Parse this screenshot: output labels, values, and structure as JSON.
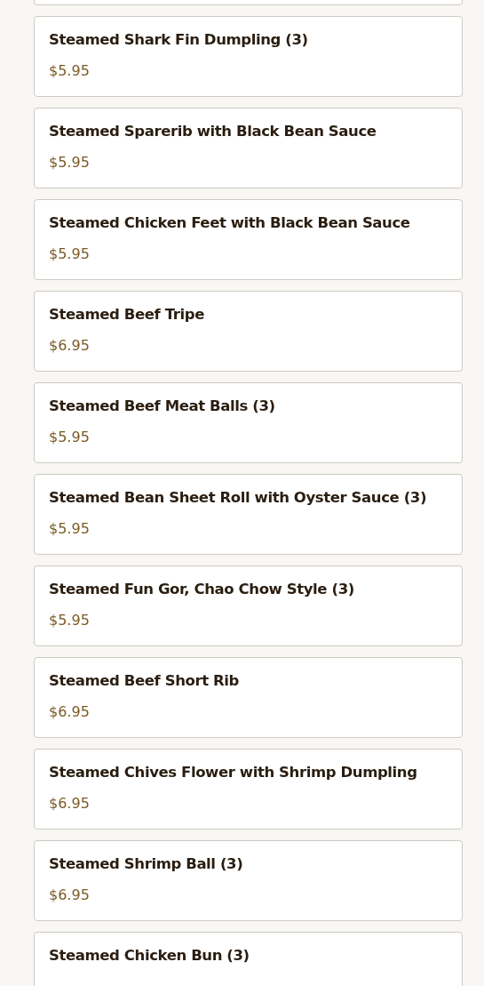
{
  "cut_off_card_above": true,
  "menu_items": [
    {
      "name": "Steamed Shark Fin Dumpling (3)",
      "price": "$5.95"
    },
    {
      "name": "Steamed Sparerib with Black Bean Sauce",
      "price": "$5.95"
    },
    {
      "name": "Steamed Chicken Feet with Black Bean Sauce",
      "price": "$5.95"
    },
    {
      "name": "Steamed Beef Tripe",
      "price": "$6.95"
    },
    {
      "name": "Steamed Beef Meat Balls (3)",
      "price": "$5.95"
    },
    {
      "name": "Steamed Bean Sheet Roll with Oyster Sauce (3)",
      "price": "$5.95"
    },
    {
      "name": "Steamed Fun Gor, Chao Chow Style (3)",
      "price": "$5.95"
    },
    {
      "name": "Steamed Beef Short Rib",
      "price": "$6.95"
    },
    {
      "name": "Steamed Chives Flower with Shrimp Dumpling",
      "price": "$6.95"
    },
    {
      "name": "Steamed Shrimp Ball (3)",
      "price": "$6.95"
    },
    {
      "name": "Steamed Chicken Bun (3)"
    }
  ]
}
